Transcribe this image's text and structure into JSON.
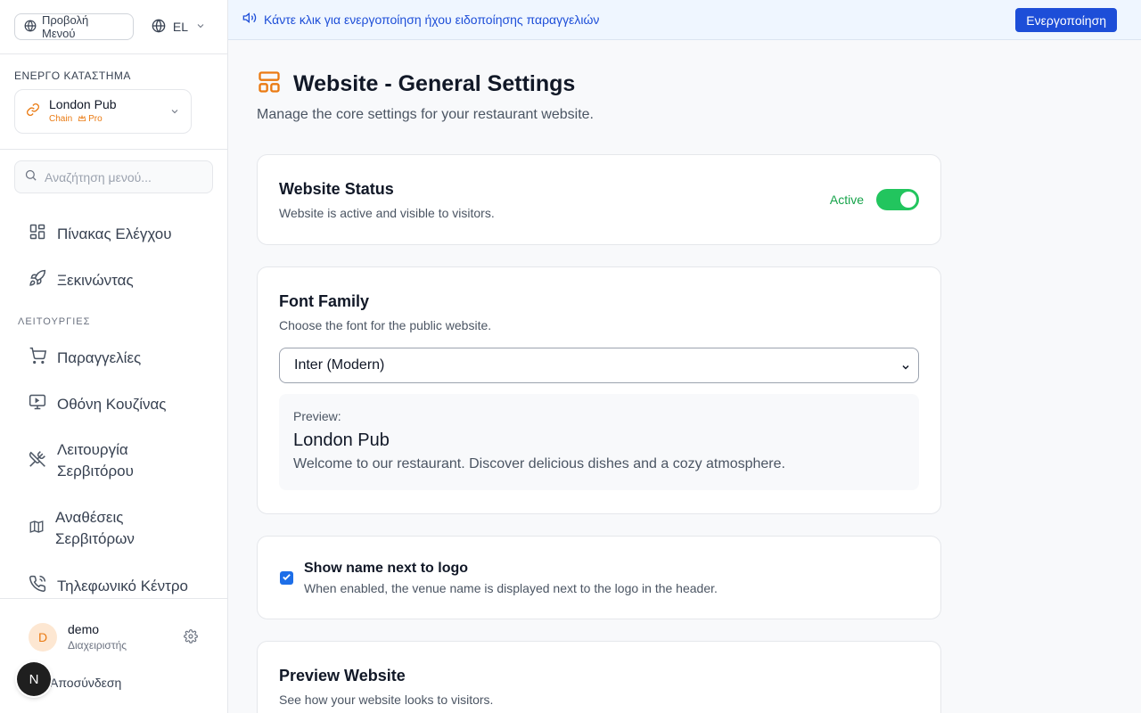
{
  "sidebar": {
    "menu_view_label": "Προβολή Μενού",
    "language": "EL",
    "store_section_title": "ΕΝΕΡΓΟ ΚΑΤΑΣΤΗΜΑ",
    "store": {
      "name": "London Pub",
      "type": "Chain",
      "plan": "Pro"
    },
    "search_placeholder": "Αναζήτηση μενού...",
    "items_top": [
      {
        "label": "Πίνακας Ελέγχου",
        "icon": "dashboard-icon"
      },
      {
        "label": "Ξεκινώντας",
        "icon": "rocket-icon"
      }
    ],
    "section_label": "ΛΕΙΤΟΥΡΓΙΕΣ",
    "items": [
      {
        "label": "Παραγγελίες",
        "icon": "cart-icon"
      },
      {
        "label": "Οθόνη Κουζίνας",
        "icon": "monitor-icon"
      },
      {
        "label": "Λειτουργία Σερβιτόρου",
        "icon": "utensils-crossed-icon"
      },
      {
        "label": "Αναθέσεις Σερβιτόρων",
        "icon": "map-icon"
      },
      {
        "label": "Τηλεφωνικό Κέντρο",
        "icon": "phone-icon"
      }
    ],
    "user": {
      "initial": "D",
      "name": "demo",
      "role": "Διαχειριστής"
    },
    "logout_label": "Αποσύνδεση",
    "badge_letter": "N"
  },
  "banner": {
    "text": "Κάντε κλικ για ενεργοποίηση ήχου ειδοποίησης παραγγελιών",
    "button_label": "Ενεργοποίηση"
  },
  "page": {
    "title": "Website - General Settings",
    "subtitle": "Manage the core settings for your restaurant website."
  },
  "status_card": {
    "title": "Website Status",
    "desc": "Website is active and visible to visitors.",
    "toggle_label": "Active",
    "toggle_on": true
  },
  "font_card": {
    "title": "Font Family",
    "desc": "Choose the font for the public website.",
    "selected": "Inter (Modern)",
    "preview_label": "Preview:",
    "preview_name": "London Pub",
    "preview_text": "Welcome to our restaurant. Discover delicious dishes and a cozy atmosphere."
  },
  "logo_card": {
    "title": "Show name next to logo",
    "desc": "When enabled, the venue name is displayed next to the logo in the header.",
    "checked": true
  },
  "preview_card": {
    "title": "Preview Website",
    "desc": "See how your website looks to visitors."
  },
  "colors": {
    "accent_orange": "#ea7a12",
    "primary_blue": "#1d4ed8",
    "toggle_green": "#22c55e"
  }
}
